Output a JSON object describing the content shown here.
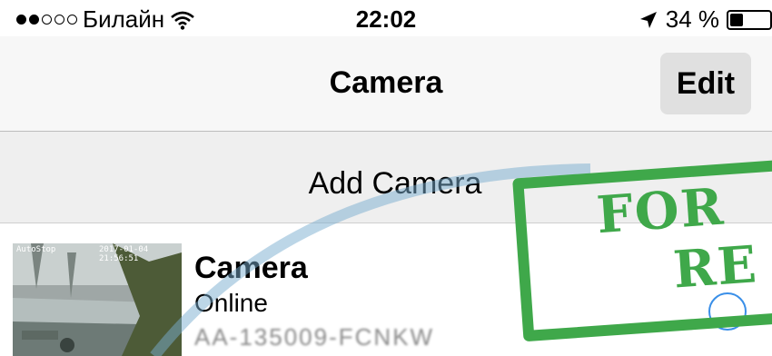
{
  "status_bar": {
    "carrier": "Билайн",
    "time": "22:02",
    "battery_text": "34 %",
    "battery_level": 0.34,
    "signal_bars_filled": 2,
    "signal_bars_total": 5,
    "icons": [
      "wifi-icon",
      "location-arrow-icon",
      "battery-icon"
    ]
  },
  "nav": {
    "title": "Camera",
    "edit_label": "Edit"
  },
  "add_camera": {
    "label": "Add Camera"
  },
  "cameras": [
    {
      "thumbnail_timestamp": "2017-01-04 21:56:51",
      "thumbnail_watermark": "AutoStop",
      "name": "Camera",
      "status": "Online",
      "id": "AA-135009-FCNKW"
    }
  ],
  "watermark": {
    "line1": "FOR",
    "line2": "RE",
    "color": "#3fa84a"
  },
  "colors": {
    "accent": "#3a8fe8",
    "nav_bg": "#f7f7f7",
    "row_bg": "#efefef"
  }
}
